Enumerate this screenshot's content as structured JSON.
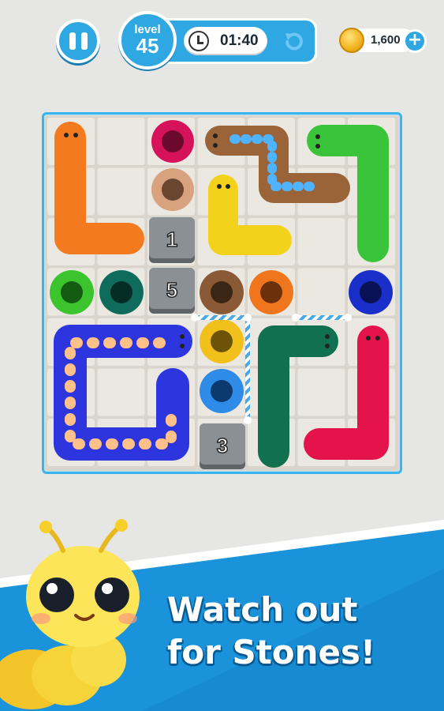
{
  "hud": {
    "pause_icon": "pause-icon",
    "level_label": "level",
    "level_number": "45",
    "timer": "01:40",
    "clock_icon": "clock-icon",
    "undo_icon": "undo-icon",
    "coins": "1,600",
    "add_label": "+"
  },
  "board": {
    "stones": [
      {
        "label": "1"
      },
      {
        "label": "5"
      },
      {
        "label": "3"
      }
    ],
    "hole_colors": [
      "#d6135a",
      "#d9a27f",
      "#3cc42f",
      "#0f6b5c",
      "#8a5a36",
      "#f0761e",
      "#1a2fc9",
      "#f2c01a",
      "#2f8be8"
    ],
    "worm_colors": {
      "orange": "#f47a1f",
      "brown": "#9b6438",
      "green": "#39c43a",
      "yellow": "#f2d21b",
      "blue": "#2d35de",
      "dark_green": "#11704f",
      "pink": "#e4134c"
    }
  },
  "banner": {
    "line1": "Watch out",
    "line2": "for Stones!",
    "mascot": "caterpillar-mascot"
  }
}
